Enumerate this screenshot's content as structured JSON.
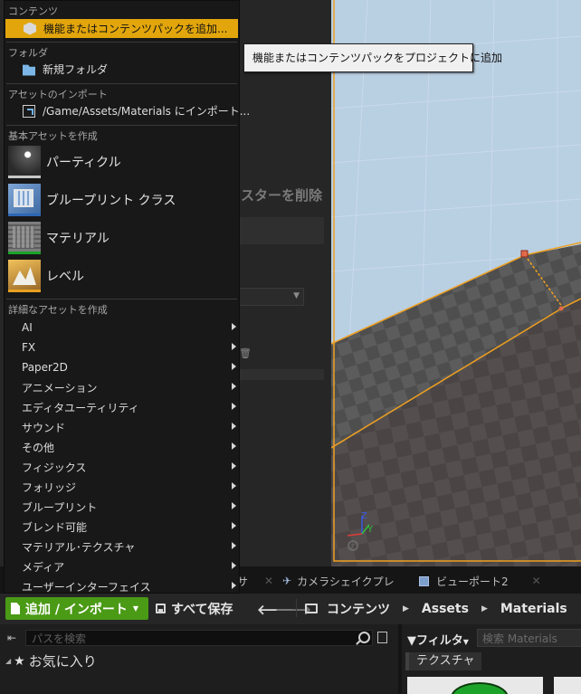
{
  "menu": {
    "sections": {
      "content": "コンテンツ",
      "folder": "フォルダ",
      "asset_import": "アセットのインポート",
      "basic_assets": "基本アセットを作成",
      "advanced_assets": "詳細なアセットを作成"
    },
    "add_feature_pack": "機能またはコンテンツパックを追加...",
    "new_folder": "新規フォルダ",
    "import_to": "/Game/Assets/Materials にインポート...",
    "basic_items": [
      "パーティクル",
      "ブループリント クラス",
      "マテリアル",
      "レベル"
    ],
    "advanced_items": [
      "AI",
      "FX",
      "Paper2D",
      "アニメーション",
      "エディタユーティリティ",
      "サウンド",
      "その他",
      "フィジックス",
      "フォリッジ",
      "ブループリント",
      "ブレンド可能",
      "マテリアル･テクスチャ",
      "メディア",
      "ユーザーインターフェイス"
    ]
  },
  "tooltip": "機能またはコンテンツパックをプロジェクトに追加",
  "background": {
    "delete_text": "スターを削除"
  },
  "tabs": {
    "tab1": "サ",
    "tab2": "カメラシェイクプレ",
    "tab3": "ビューポート2"
  },
  "toolbar": {
    "add_import": "追加 / インポート",
    "save_all": "すべて保存",
    "breadcrumb": [
      "コンテンツ",
      "Assets",
      "Materials"
    ]
  },
  "sources": {
    "path_search_placeholder": "パスを検索",
    "favorites": "お気に入り"
  },
  "assets": {
    "filter_label": "フィルタ",
    "search_placeholder": "検索 Materials",
    "active_filter": "テクスチャ"
  },
  "colors": {
    "highlight": "#e2a60c",
    "add_button": "#4a9a16",
    "selection_outline": "#f0a020"
  }
}
